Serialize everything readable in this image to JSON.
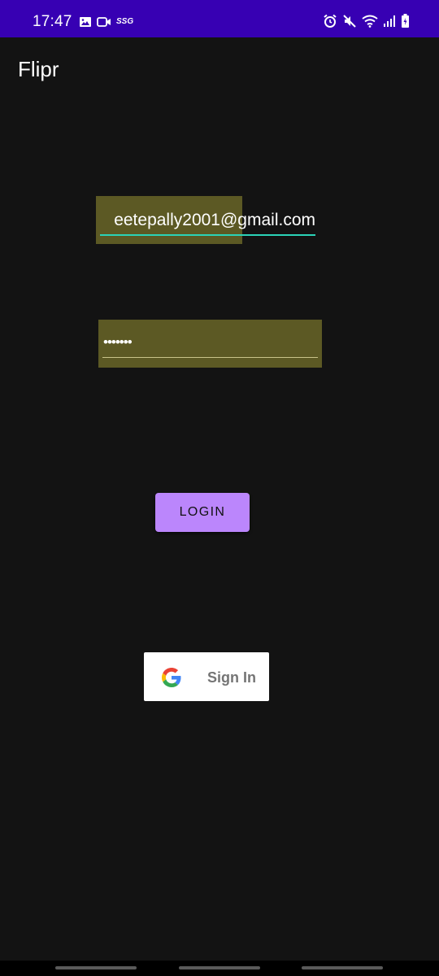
{
  "status_bar": {
    "time": "17:47",
    "network_label": "SSG",
    "left_icons": [
      "image-icon",
      "video-camera-icon"
    ],
    "right_icons": [
      "alarm-icon",
      "mute-icon",
      "wifi-icon",
      "signal-icon",
      "battery-icon"
    ]
  },
  "app_bar": {
    "title": "Flipr"
  },
  "login_form": {
    "email_value": "eetepally2001@gmail.com",
    "password_value": "•••••••",
    "login_label": "LOGIN"
  },
  "google_sign_in": {
    "label": "Sign In",
    "icon": "google-icon"
  },
  "nav_bar": {
    "buttons": [
      "recents-button",
      "home-button",
      "back-button"
    ]
  },
  "colors": {
    "status_bar": "#3700b3",
    "background": "#131313",
    "field_highlight": "#5c5924",
    "email_underline": "#2bd3b8",
    "login_button": "#bb86fc",
    "google_button": "#ffffff"
  }
}
